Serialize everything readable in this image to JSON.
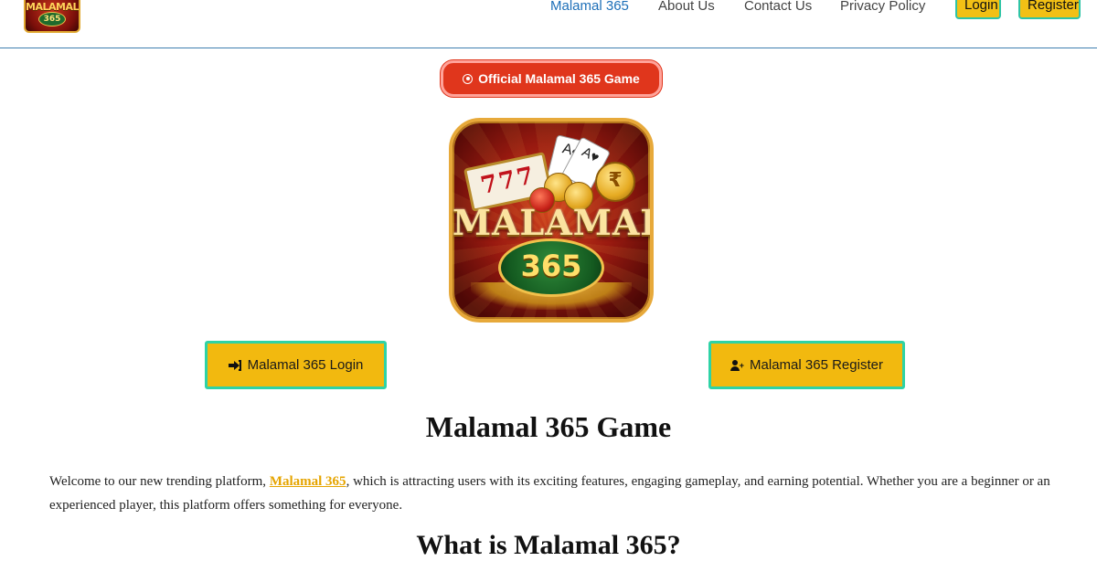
{
  "header": {
    "logo_line1": "MALAMAL",
    "logo_line2": "365",
    "nav": [
      {
        "label": "Malamal 365",
        "active": true
      },
      {
        "label": "About Us"
      },
      {
        "label": "Contact Us"
      },
      {
        "label": "Privacy Policy"
      }
    ],
    "login_label": "Login",
    "register_label": "Register"
  },
  "badge": {
    "label": "Official Malamal 365 Game",
    "icon": "dot-circle-icon"
  },
  "game_logo": {
    "title": "MALAMAL",
    "number": "365",
    "slot": "777",
    "card1": "A♠",
    "card2": "A♥",
    "rupee": "₹"
  },
  "actions": {
    "login_label": "Malamal 365 Login",
    "login_icon": "sign-in-icon",
    "register_label": "Malamal 365 Register",
    "register_icon": "user-plus-icon"
  },
  "content": {
    "heading": "Malamal 365 Game",
    "intro_before": "Welcome to our new trending platform, ",
    "intro_link": "Malamal 365",
    "intro_after": ", which is attracting users with its exciting features, engaging gameplay, and earning potential. Whether you are a beginner or an experienced player, this platform offers something for everyone.",
    "subheading": "What is Malamal 365?"
  },
  "colors": {
    "accent_yellow": "#f2b90f",
    "teal_border": "#2ed3a6",
    "badge_red": "#e0361c",
    "nav_active": "#1d6fb8",
    "header_border": "#3f7fb0"
  }
}
